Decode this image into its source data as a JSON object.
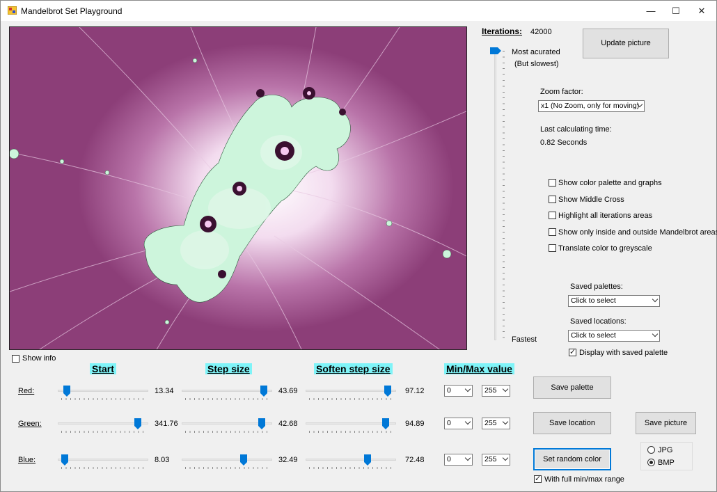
{
  "window": {
    "title": "Mandelbrot Set Playground",
    "minimize": "—",
    "maximize": "☐",
    "close": "✕"
  },
  "iterations": {
    "label": "Iterations:",
    "value": "42000",
    "top_label": "Most acurated",
    "top_sublabel": "(But slowest)",
    "bottom_label": "Fastest"
  },
  "update_button": "Update picture",
  "zoom": {
    "label": "Zoom factor:",
    "selected": "x1 (No Zoom, only for moving)"
  },
  "calc": {
    "label": "Last calculating time:",
    "value": "0.82 Seconds"
  },
  "options": [
    {
      "label": "Show color palette and graphs",
      "checked": false
    },
    {
      "label": "Show Middle Cross",
      "checked": false
    },
    {
      "label": "Highlight all iterations areas",
      "checked": false
    },
    {
      "label": "Show only inside and outside Mandelbrot areas",
      "checked": false
    },
    {
      "label": "Translate color to greyscale",
      "checked": false
    }
  ],
  "saved_palettes": {
    "label": "Saved palettes:",
    "selected": "Click to select"
  },
  "saved_locations": {
    "label": "Saved locations:",
    "selected": "Click to select"
  },
  "display_saved_palette": {
    "label": "Display with saved palette",
    "checked": true
  },
  "show_info": {
    "label": "Show info",
    "checked": false
  },
  "headers": {
    "start": "Start",
    "step": "Step size",
    "soften": "Soften step size",
    "minmax": "Min/Max value"
  },
  "rows": [
    {
      "label": "Red:",
      "start": "13.34",
      "start_pct": 0.07,
      "step": "43.69",
      "step_pct": 0.94,
      "soften": "97.12",
      "soften_pct": 0.94,
      "min": "0",
      "max": "255"
    },
    {
      "label": "Green:",
      "start": "341.76",
      "start_pct": 0.92,
      "step": "42.68",
      "step_pct": 0.92,
      "soften": "94.89",
      "soften_pct": 0.92,
      "min": "0",
      "max": "255"
    },
    {
      "label": "Blue:",
      "start": "8.03",
      "start_pct": 0.04,
      "step": "32.49",
      "step_pct": 0.7,
      "soften": "72.48",
      "soften_pct": 0.7,
      "min": "0",
      "max": "255"
    }
  ],
  "buttons": {
    "save_palette": "Save  palette",
    "save_location": "Save location",
    "save_picture": "Save picture",
    "random_color": "Set random color"
  },
  "full_range": {
    "label": "With full min/max range",
    "checked": true
  },
  "format": {
    "jpg": "JPG",
    "bmp": "BMP",
    "selected": "BMP"
  },
  "colors": {
    "accent": "#0078d7",
    "header_bg": "#7ff4f8",
    "fractal_bg": "#8c3e78",
    "fractal_body": "#c9f2d8"
  }
}
